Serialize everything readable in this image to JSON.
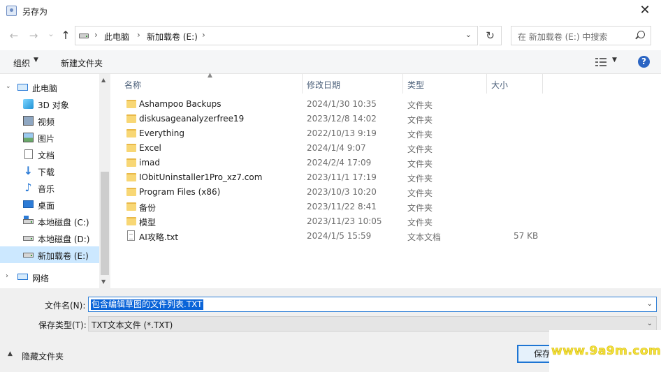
{
  "window": {
    "title": "另存为",
    "close_glyph": "✕"
  },
  "address": {
    "back_glyph": "←",
    "forward_glyph": "→",
    "recent_glyph": "⌄",
    "up_glyph": "↑",
    "crumbs": [
      "此电脑",
      "新加载卷 (E:)"
    ],
    "separator": "›",
    "dropdown_glyph": "⌄",
    "refresh_glyph": "↻"
  },
  "search": {
    "placeholder": "在 新加载卷 (E:) 中搜索"
  },
  "toolbar": {
    "organize": "组织",
    "new_folder": "新建文件夹",
    "help": "?"
  },
  "nav": {
    "items": [
      {
        "label": "此电脑",
        "icon": "pc-icon"
      },
      {
        "label": "3D 对象",
        "icon": "3d-objects-icon"
      },
      {
        "label": "视频",
        "icon": "video-icon"
      },
      {
        "label": "图片",
        "icon": "pictures-icon"
      },
      {
        "label": "文档",
        "icon": "documents-icon"
      },
      {
        "label": "下载",
        "icon": "download-icon"
      },
      {
        "label": "音乐",
        "icon": "music-icon"
      },
      {
        "label": "桌面",
        "icon": "desktop-icon"
      },
      {
        "label": "本地磁盘 (C:)",
        "icon": "drive-icon"
      },
      {
        "label": "本地磁盘 (D:)",
        "icon": "drive-icon"
      },
      {
        "label": "新加载卷 (E:)",
        "icon": "drive-icon",
        "selected": true
      },
      {
        "label": "网络",
        "icon": "network-icon"
      }
    ]
  },
  "list": {
    "columns": {
      "name": "名称",
      "date": "修改日期",
      "type": "类型",
      "size": "大小"
    },
    "rows": [
      {
        "name": "Ashampoo Backups",
        "date": "2024/1/30 10:35",
        "type": "文件夹",
        "size": ""
      },
      {
        "name": "diskusageanalyzerfree19",
        "date": "2023/12/8 14:02",
        "type": "文件夹",
        "size": ""
      },
      {
        "name": "Everything",
        "date": "2022/10/13 9:19",
        "type": "文件夹",
        "size": ""
      },
      {
        "name": "Excel",
        "date": "2024/1/4 9:07",
        "type": "文件夹",
        "size": ""
      },
      {
        "name": "imad",
        "date": "2024/2/4 17:09",
        "type": "文件夹",
        "size": ""
      },
      {
        "name": "IObitUninstaller1Pro_xz7.com",
        "date": "2023/11/1 17:19",
        "type": "文件夹",
        "size": ""
      },
      {
        "name": "Program Files (x86)",
        "date": "2023/10/3 10:20",
        "type": "文件夹",
        "size": ""
      },
      {
        "name": "备份",
        "date": "2023/11/22 8:41",
        "type": "文件夹",
        "size": ""
      },
      {
        "name": "模型",
        "date": "2023/11/23 10:05",
        "type": "文件夹",
        "size": ""
      },
      {
        "name": "AI攻略.txt",
        "date": "2024/1/5 15:59",
        "type": "文本文档",
        "size": "57 KB"
      }
    ]
  },
  "form": {
    "filename_label": "文件名(N):",
    "filename_value": "包含编辑草图的文件列表.TXT",
    "filetype_label": "保存类型(T):",
    "filetype_value": "TXT文本文件 (*.TXT)",
    "hide_folders": "隐藏文件夹",
    "save_button": "保存"
  },
  "watermark": "www.9a9m.com"
}
